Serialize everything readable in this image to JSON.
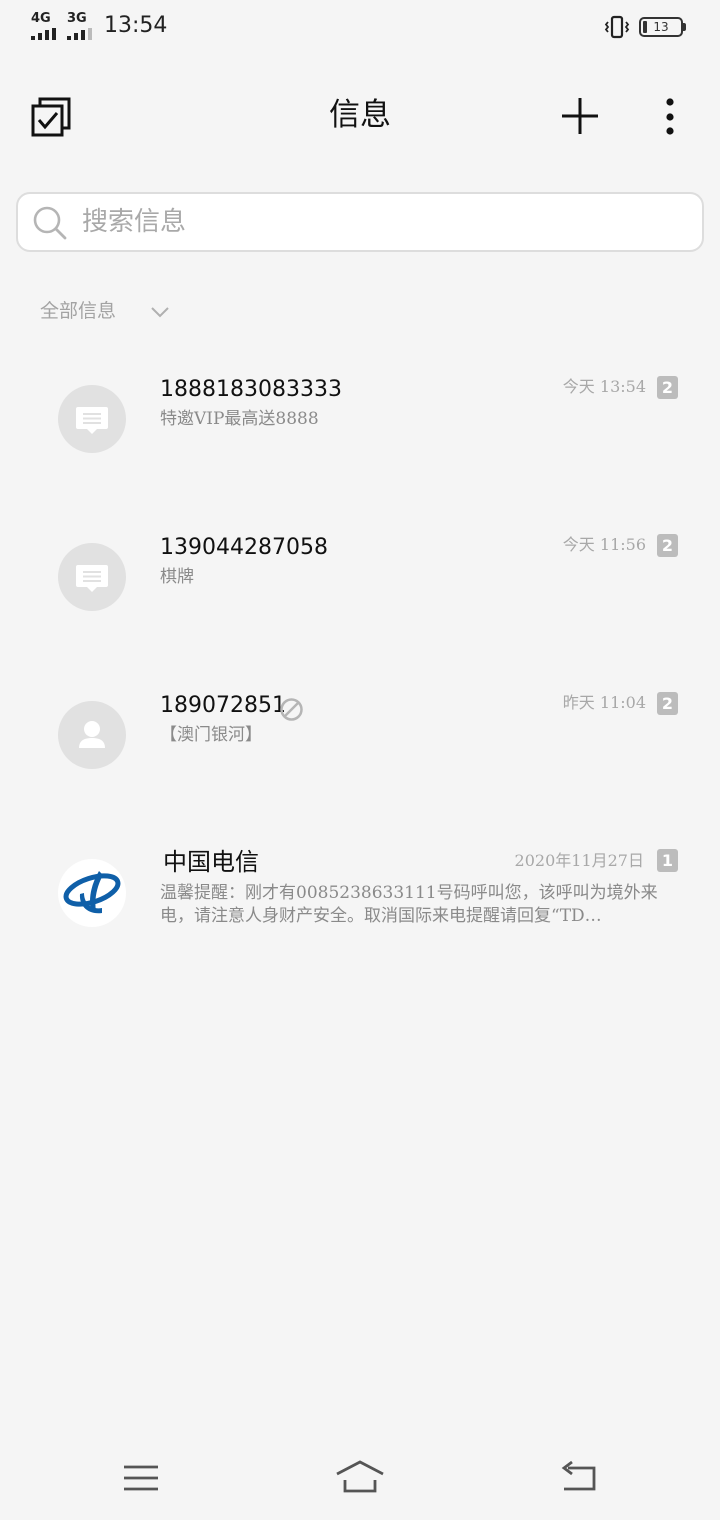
{
  "status_bar": {
    "signal_1": "4G",
    "signal_2": "3G",
    "time": "13:54",
    "battery": "13",
    "icons": [
      "signal-icon",
      "vibrate-icon",
      "battery-icon"
    ]
  },
  "header": {
    "title": "信息",
    "icons": [
      "multi-select-icon",
      "plus-icon",
      "more-vertical-icon"
    ]
  },
  "search": {
    "placeholder": "搜索信息",
    "icon": "search-icon"
  },
  "filter": {
    "label": "全部信息",
    "icon": "chevron-down-icon"
  },
  "conversations": [
    {
      "name": "1888183083333",
      "preview": "特邀VIP最高送8888",
      "time": "今天 13:54",
      "count": "2",
      "avatar": "message-bubble-icon"
    },
    {
      "name": "139044287058",
      "preview": "棋牌",
      "time": "今天 11:56",
      "count": "2",
      "avatar": "message-bubble-icon"
    },
    {
      "name": "189072851",
      "preview": "【澳门银河】",
      "time": "昨天 11:04",
      "count": "2",
      "avatar": "person-icon",
      "status_icon": "blocked-icon"
    },
    {
      "name": "中国电信",
      "preview_line1": "温馨提醒：刚才有0085238633111号码呼叫您，该呼叫为境外来",
      "preview_line2": "电，请注意人身财产安全。取消国际来电提醒请回复“TD…",
      "time": "2020年11月27日",
      "count": "1",
      "avatar": "china-telecom-logo"
    }
  ],
  "nav_bar": {
    "icons": [
      "menu-icon",
      "home-icon",
      "back-icon"
    ]
  },
  "colors": {
    "background": "#f5f5f5",
    "badge": "#bcbcbc",
    "avatar": "#e1e1e1",
    "telecom_blue": "#0f5fa8"
  }
}
